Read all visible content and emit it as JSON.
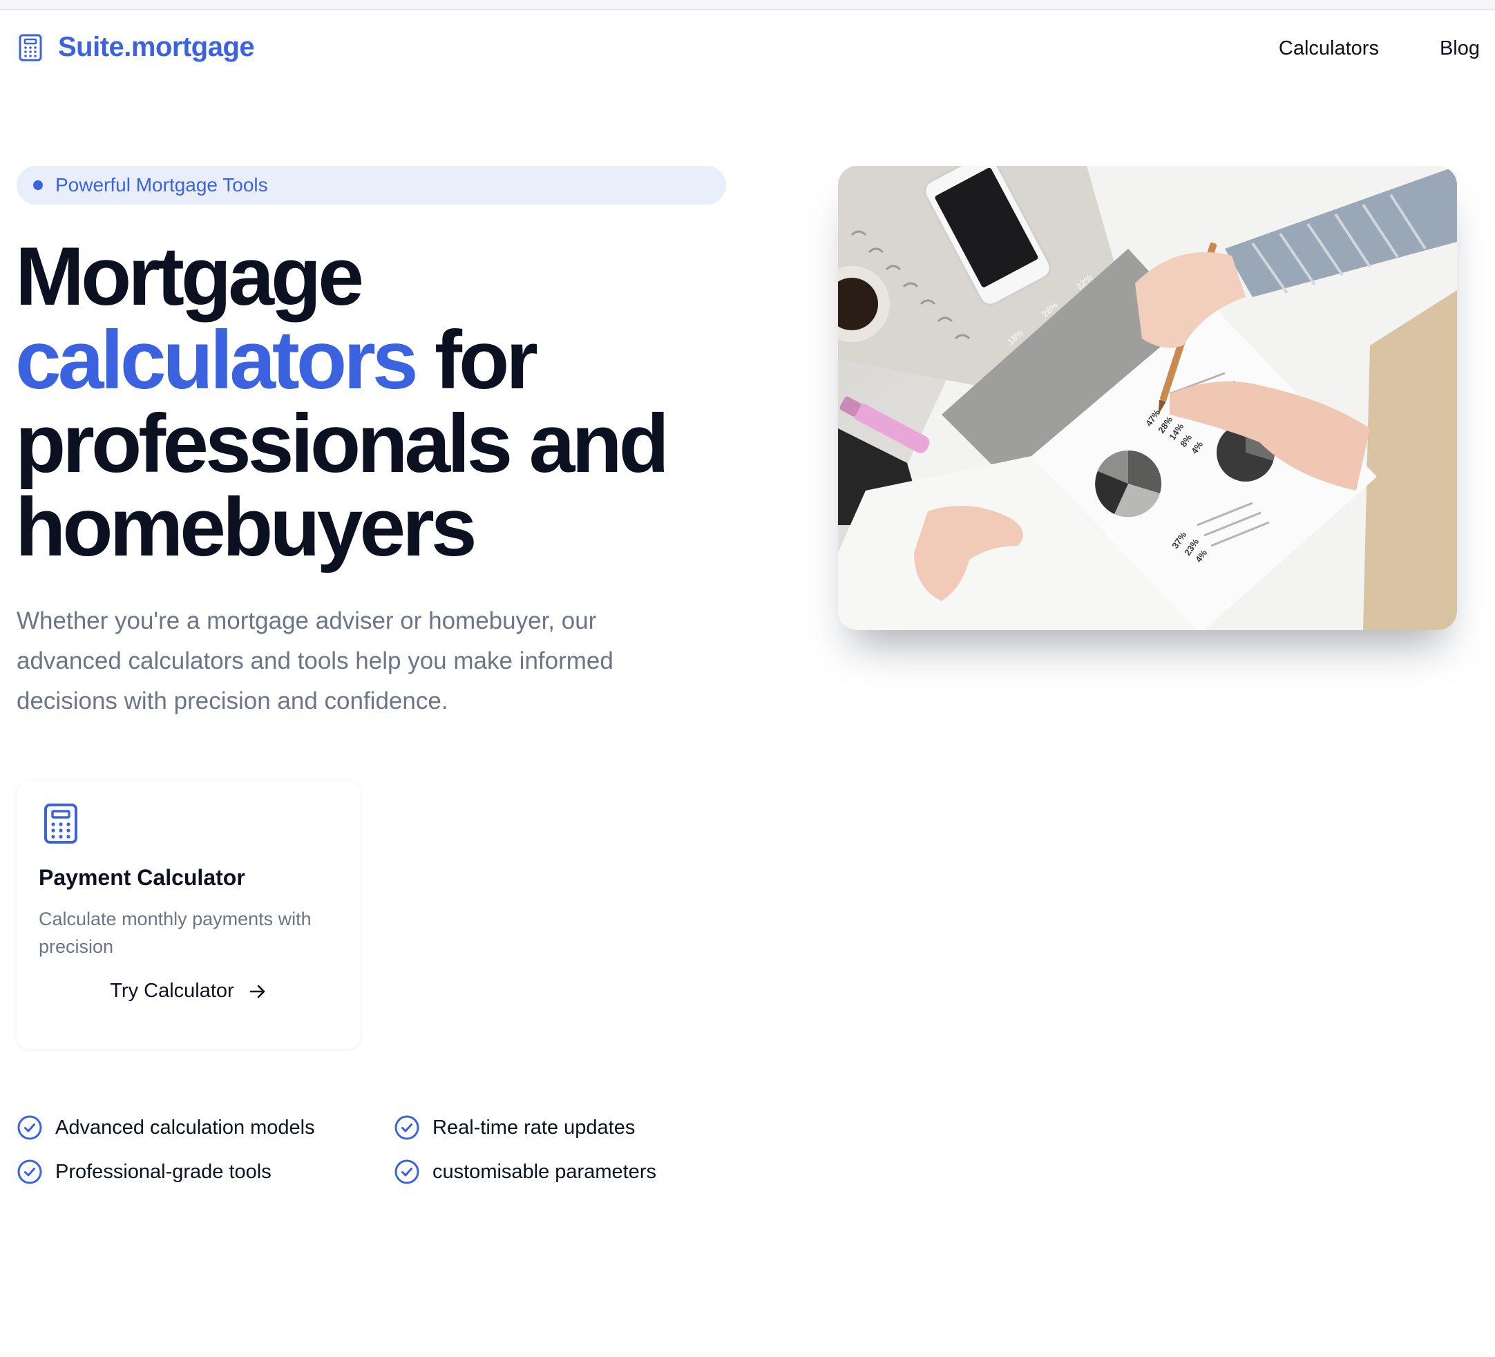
{
  "header": {
    "brand": "Suite.mortgage",
    "brand_icon": "calculator-icon",
    "nav": [
      "Calculators",
      "Blog"
    ]
  },
  "hero": {
    "badge": "Powerful Mortgage Tools",
    "title": {
      "line1": "Mortgage",
      "accent": "calculators",
      "after_accent": " for",
      "line3": "professionals and",
      "line4": "homebuyers"
    },
    "subtitle": "Whether you're a mortgage adviser or homebuyer, our advanced calculators and tools help you make informed decisions with precision and confidence.",
    "photo_labels": [
      "47%",
      "28%",
      "14%",
      "8%",
      "4%",
      "37%",
      "23%",
      "4%",
      "18%",
      "26%",
      "22%"
    ]
  },
  "card": {
    "icon": "calculator-icon",
    "title": "Payment Calculator",
    "description": "Calculate monthly payments with precision",
    "cta": "Try Calculator",
    "cta_icon": "arrow-right-icon"
  },
  "features": [
    "Advanced calculation models",
    "Real-time rate updates",
    "Professional-grade tools",
    "customisable parameters"
  ],
  "colors": {
    "accent": "#3b63e0",
    "text": "#0b1120",
    "muted": "#6b7587",
    "badge_bg": "#e9eefb"
  }
}
